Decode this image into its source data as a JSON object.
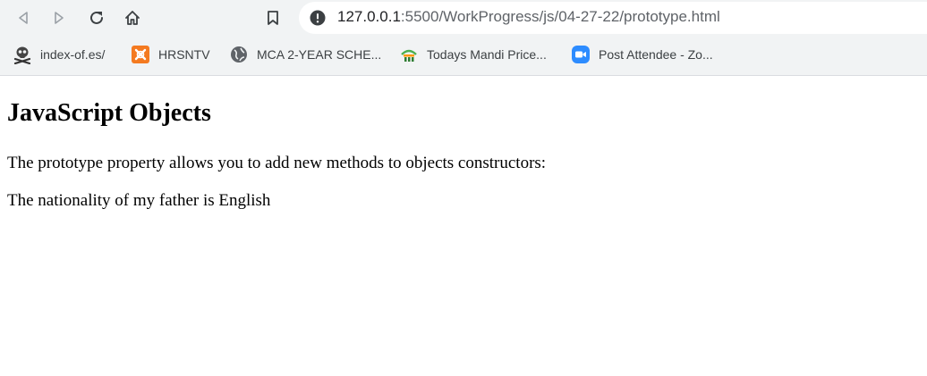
{
  "browser": {
    "address_bar": {
      "host": "127.0.0.1",
      "path": ":5500/WorkProgress/js/04-27-22/prototype.html"
    },
    "bookmarks": [
      {
        "label": "index-of.es/",
        "icon": "skull-crossbones-icon"
      },
      {
        "label": "HRSNTV",
        "icon": "xampp-logo-icon"
      },
      {
        "label": "MCA 2-YEAR SCHE...",
        "icon": "globe-icon"
      },
      {
        "label": "Todays Mandi Price...",
        "icon": "mandi-logo-icon"
      },
      {
        "label": "Post Attendee - Zo...",
        "icon": "zoom-video-icon"
      }
    ]
  },
  "page": {
    "heading": "JavaScript Objects",
    "description": "The prototype property allows you to add new methods to objects constructors:",
    "result": "The nationality of my father is English"
  },
  "colors": {
    "chrome_bg": "#f1f3f4",
    "toolbar_icon": "#3c4043",
    "disabled_icon": "#9aa0a6",
    "xampp_orange": "#f47a20",
    "zoom_blue": "#2d8cff"
  }
}
